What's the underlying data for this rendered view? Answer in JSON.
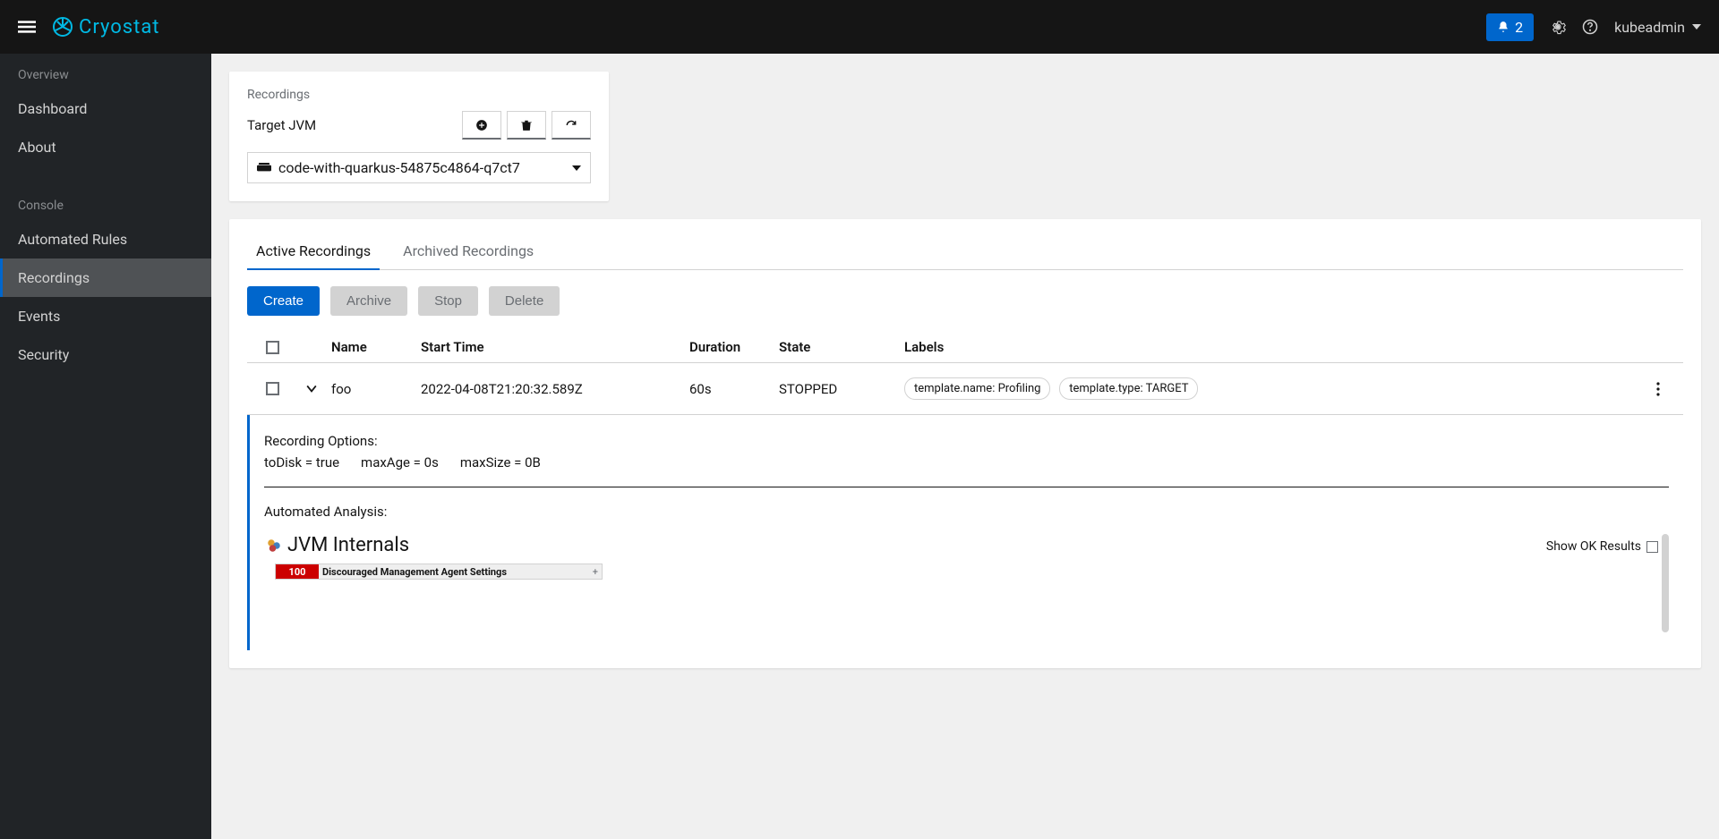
{
  "header": {
    "brand": "Cryostat",
    "notif_count": "2",
    "username": "kubeadmin"
  },
  "sidebar": {
    "section1": "Overview",
    "items1": [
      "Dashboard",
      "About"
    ],
    "section2": "Console",
    "items2": [
      "Automated Rules",
      "Recordings",
      "Events",
      "Security"
    ]
  },
  "page": {
    "breadcrumb": "Recordings",
    "target_label": "Target JVM",
    "target_value": "code-with-quarkus-54875c4864-q7ct7"
  },
  "tabs": {
    "active": "Active Recordings",
    "archived": "Archived Recordings"
  },
  "actions": {
    "create": "Create",
    "archive": "Archive",
    "stop": "Stop",
    "delete": "Delete"
  },
  "table": {
    "headers": {
      "name": "Name",
      "start": "Start Time",
      "duration": "Duration",
      "state": "State",
      "labels": "Labels"
    },
    "row": {
      "name": "foo",
      "start": "2022-04-08T21:20:32.589Z",
      "duration": "60s",
      "state": "STOPPED",
      "label1": "template.name: Profiling",
      "label2": "template.type: TARGET"
    }
  },
  "expanded": {
    "options_title": "Recording Options:",
    "opt1": "toDisk = true",
    "opt2": "maxAge = 0s",
    "opt3": "maxSize = 0B",
    "analysis_title": "Automated Analysis:",
    "show_ok": "Show OK Results",
    "section": "JVM Internals",
    "item_score": "100",
    "item_text": "Discouraged Management Agent Settings",
    "item_plus": "+"
  }
}
